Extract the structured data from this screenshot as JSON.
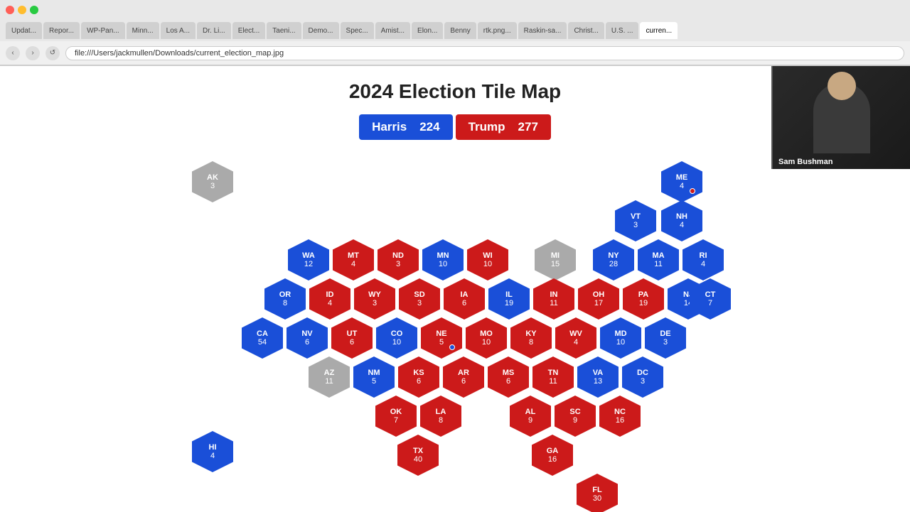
{
  "browser": {
    "url": "file:///Users/jackmullen/Downloads/current_election_map.jpg",
    "tabs": [
      {
        "label": "Updat...",
        "active": false
      },
      {
        "label": "Repor...",
        "active": false
      },
      {
        "label": "WP-Pan...",
        "active": false
      },
      {
        "label": "Minn...",
        "active": false
      },
      {
        "label": "Los A...",
        "active": false
      },
      {
        "label": "Dr. Li...",
        "active": false
      },
      {
        "label": "Elect...",
        "active": false
      },
      {
        "label": "Taeni...",
        "active": false
      },
      {
        "label": "Demo...",
        "active": false
      },
      {
        "label": "Spec...",
        "active": false
      },
      {
        "label": "Amist...",
        "active": false
      },
      {
        "label": "Elon...",
        "active": false
      },
      {
        "label": "Benny",
        "active": false
      },
      {
        "label": "rtk.png...",
        "active": false
      },
      {
        "label": "Raskin-sa...",
        "active": false
      },
      {
        "label": "Christ...",
        "active": false
      },
      {
        "label": "U.S. ...",
        "active": false
      },
      {
        "label": "curren...",
        "active": true
      }
    ]
  },
  "page": {
    "title": "2024 Election Tile Map",
    "harris_label": "Harris",
    "harris_votes": "224",
    "trump_label": "Trump",
    "trump_votes": "277"
  },
  "webcam": {
    "person_name": "Sam Bushman"
  },
  "states": [
    {
      "abbr": "AK",
      "votes": 3,
      "color": "gray",
      "col": 0,
      "row": 0
    },
    {
      "abbr": "HI",
      "votes": 4,
      "color": "blue",
      "col": 0,
      "row": 7
    },
    {
      "abbr": "ME",
      "votes": 4,
      "color": "blue",
      "col": 13,
      "row": 0,
      "dot": "red"
    },
    {
      "abbr": "VT",
      "votes": 3,
      "color": "blue",
      "col": 12,
      "row": 1
    },
    {
      "abbr": "NH",
      "votes": 4,
      "color": "blue",
      "col": 13,
      "row": 1
    },
    {
      "abbr": "WA",
      "votes": 12,
      "color": "blue",
      "col": 3,
      "row": 2
    },
    {
      "abbr": "MT",
      "votes": 4,
      "color": "red",
      "col": 4,
      "row": 2
    },
    {
      "abbr": "ND",
      "votes": 3,
      "color": "red",
      "col": 5,
      "row": 2
    },
    {
      "abbr": "MN",
      "votes": 10,
      "color": "blue",
      "col": 6,
      "row": 2
    },
    {
      "abbr": "WI",
      "votes": 10,
      "color": "red",
      "col": 7,
      "row": 2
    },
    {
      "abbr": "MI",
      "votes": 15,
      "color": "gray",
      "col": 9,
      "row": 2
    },
    {
      "abbr": "NY",
      "votes": 28,
      "color": "blue",
      "col": 11,
      "row": 2
    },
    {
      "abbr": "MA",
      "votes": 11,
      "color": "blue",
      "col": 12,
      "row": 2
    },
    {
      "abbr": "RI",
      "votes": 4,
      "color": "blue",
      "col": 13,
      "row": 2
    },
    {
      "abbr": "OR",
      "votes": 8,
      "color": "blue",
      "col": 2.5,
      "row": 3
    },
    {
      "abbr": "ID",
      "votes": 4,
      "color": "red",
      "col": 3.5,
      "row": 3
    },
    {
      "abbr": "WY",
      "votes": 3,
      "color": "red",
      "col": 4.5,
      "row": 3
    },
    {
      "abbr": "SD",
      "votes": 3,
      "color": "red",
      "col": 5.5,
      "row": 3
    },
    {
      "abbr": "IA",
      "votes": 6,
      "color": "red",
      "col": 6.5,
      "row": 3
    },
    {
      "abbr": "IL",
      "votes": 19,
      "color": "blue",
      "col": 7.5,
      "row": 3
    },
    {
      "abbr": "IN",
      "votes": 11,
      "color": "red",
      "col": 8.5,
      "row": 3
    },
    {
      "abbr": "OH",
      "votes": 17,
      "color": "red",
      "col": 9.5,
      "row": 3
    },
    {
      "abbr": "PA",
      "votes": 19,
      "color": "red",
      "col": 10.5,
      "row": 3
    },
    {
      "abbr": "NJ",
      "votes": 14,
      "color": "blue",
      "col": 11.5,
      "row": 3
    },
    {
      "abbr": "CT",
      "votes": 7,
      "color": "blue",
      "col": 12.5,
      "row": 3
    },
    {
      "abbr": "CA",
      "votes": 54,
      "color": "blue",
      "col": 2,
      "row": 4
    },
    {
      "abbr": "NV",
      "votes": 6,
      "color": "blue",
      "col": 3,
      "row": 4
    },
    {
      "abbr": "UT",
      "votes": 6,
      "color": "red",
      "col": 4,
      "row": 4
    },
    {
      "abbr": "CO",
      "votes": 10,
      "color": "blue",
      "col": 5,
      "row": 4
    },
    {
      "abbr": "NE",
      "votes": 5,
      "color": "red",
      "col": 6,
      "row": 4,
      "dot": "blue"
    },
    {
      "abbr": "MO",
      "votes": 10,
      "color": "red",
      "col": 7,
      "row": 4
    },
    {
      "abbr": "KY",
      "votes": 8,
      "color": "red",
      "col": 8,
      "row": 4
    },
    {
      "abbr": "WV",
      "votes": 4,
      "color": "red",
      "col": 9,
      "row": 4
    },
    {
      "abbr": "MD",
      "votes": 10,
      "color": "blue",
      "col": 10,
      "row": 4
    },
    {
      "abbr": "DE",
      "votes": 3,
      "color": "blue",
      "col": 11,
      "row": 4
    },
    {
      "abbr": "AZ",
      "votes": 11,
      "color": "gray",
      "col": 3.5,
      "row": 5
    },
    {
      "abbr": "NM",
      "votes": 5,
      "color": "blue",
      "col": 4.5,
      "row": 5
    },
    {
      "abbr": "KS",
      "votes": 6,
      "color": "red",
      "col": 5.5,
      "row": 5
    },
    {
      "abbr": "AR",
      "votes": 6,
      "color": "red",
      "col": 6.5,
      "row": 5
    },
    {
      "abbr": "MS",
      "votes": 6,
      "color": "red",
      "col": 7.5,
      "row": 5
    },
    {
      "abbr": "TN",
      "votes": 11,
      "color": "red",
      "col": 8.5,
      "row": 5
    },
    {
      "abbr": "VA",
      "votes": 13,
      "color": "blue",
      "col": 9.5,
      "row": 5
    },
    {
      "abbr": "DC",
      "votes": 3,
      "color": "blue",
      "col": 10.5,
      "row": 5
    },
    {
      "abbr": "OK",
      "votes": 7,
      "color": "red",
      "col": 5,
      "row": 6
    },
    {
      "abbr": "LA",
      "votes": 8,
      "color": "red",
      "col": 6,
      "row": 6
    },
    {
      "abbr": "AL",
      "votes": 9,
      "color": "red",
      "col": 8,
      "row": 6
    },
    {
      "abbr": "SC",
      "votes": 9,
      "color": "red",
      "col": 9,
      "row": 6
    },
    {
      "abbr": "NC",
      "votes": 16,
      "color": "red",
      "col": 10,
      "row": 6
    },
    {
      "abbr": "TX",
      "votes": 40,
      "color": "red",
      "col": 5.5,
      "row": 7
    },
    {
      "abbr": "GA",
      "votes": 16,
      "color": "red",
      "col": 9.5,
      "row": 7
    },
    {
      "abbr": "FL",
      "votes": 30,
      "color": "red",
      "col": 10.5,
      "row": 8
    }
  ]
}
